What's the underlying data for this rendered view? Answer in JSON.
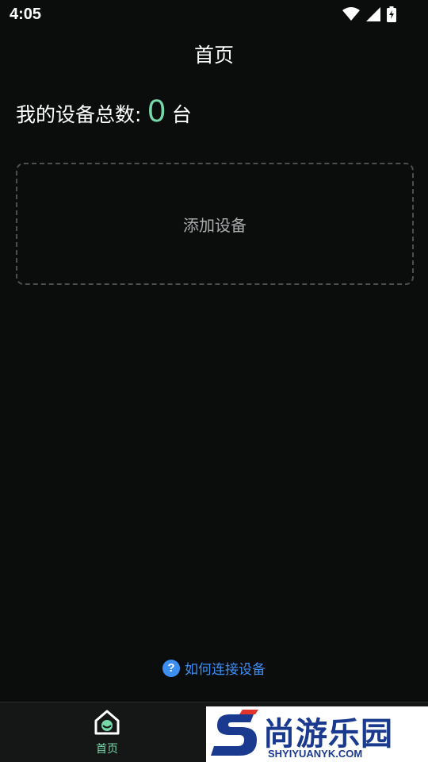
{
  "status_bar": {
    "time": "4:05",
    "icons": [
      "wifi-icon",
      "signal-icon",
      "battery-charging-icon"
    ]
  },
  "header": {
    "title": "首页"
  },
  "summary": {
    "label": "我的设备总数:",
    "count": "0",
    "unit": "台"
  },
  "add_device": {
    "label": "添加设备"
  },
  "help": {
    "label": "如何连接设备"
  },
  "bottom_nav": {
    "items": [
      {
        "label": "首页",
        "icon": "home-icon",
        "active": true
      }
    ]
  },
  "watermark": {
    "text": "尚游乐园",
    "url": "SHYIYUANYK.COM"
  },
  "colors": {
    "background": "#0b0d0d",
    "accent": "#76d8a8",
    "link": "#3d8ef2",
    "dashed_border": "#4b4f50"
  }
}
